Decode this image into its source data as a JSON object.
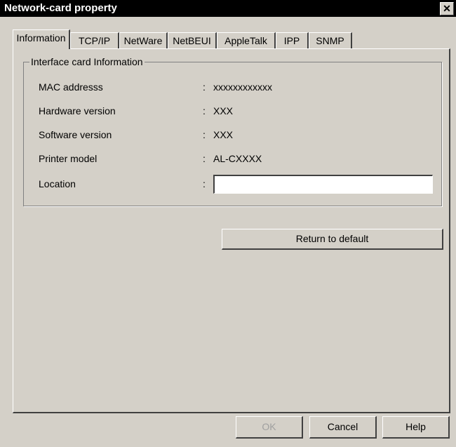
{
  "window": {
    "title": "Network-card property",
    "close_glyph": "✕"
  },
  "tabs": [
    {
      "label": "Information",
      "active": true
    },
    {
      "label": "TCP/IP"
    },
    {
      "label": "NetWare"
    },
    {
      "label": "NetBEUI"
    },
    {
      "label": "AppleTalk"
    },
    {
      "label": "IPP"
    },
    {
      "label": "SNMP"
    }
  ],
  "info_group": {
    "title": "Interface card Information",
    "colon": ":",
    "mac": {
      "label": "MAC addresss",
      "value": "xxxxxxxxxxxx"
    },
    "hardware": {
      "label": "Hardware version",
      "value": "XXX"
    },
    "software": {
      "label": "Software version",
      "value": "XXX"
    },
    "printer": {
      "label": "Printer model",
      "value": "AL-CXXXX"
    },
    "location": {
      "label": "Location",
      "value": ""
    }
  },
  "buttons": {
    "return_default": "Return to default",
    "ok": "OK",
    "cancel": "Cancel",
    "help": "Help"
  },
  "colors": {
    "face": "#d4d0c8",
    "title_bar": "#000000",
    "disabled_text": "#a0a0a0"
  }
}
